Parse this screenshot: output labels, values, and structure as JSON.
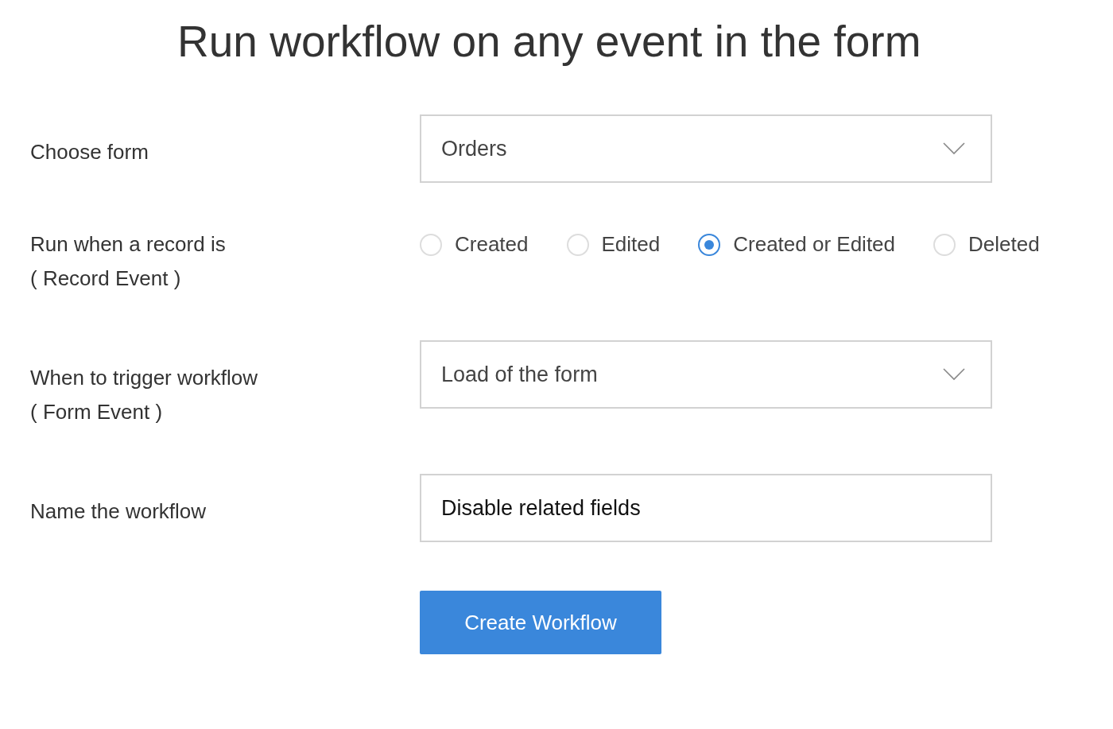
{
  "title": "Run workflow on any event in the form",
  "fields": [
    {
      "kind": "select",
      "label": "Choose form",
      "value": "Orders"
    },
    {
      "kind": "radio",
      "label": "Run when a record is",
      "sublabel": "( Record Event )",
      "options": [
        {
          "label": "Created",
          "selected": false
        },
        {
          "label": "Edited",
          "selected": false
        },
        {
          "label": "Created or Edited",
          "selected": true
        },
        {
          "label": "Deleted",
          "selected": false
        }
      ]
    },
    {
      "kind": "select",
      "label": "When to trigger workflow",
      "sublabel": "( Form Event )",
      "value": "Load of the form"
    },
    {
      "kind": "text",
      "label": "Name the workflow",
      "value": "Disable related fields"
    }
  ],
  "button": "Create Workflow"
}
